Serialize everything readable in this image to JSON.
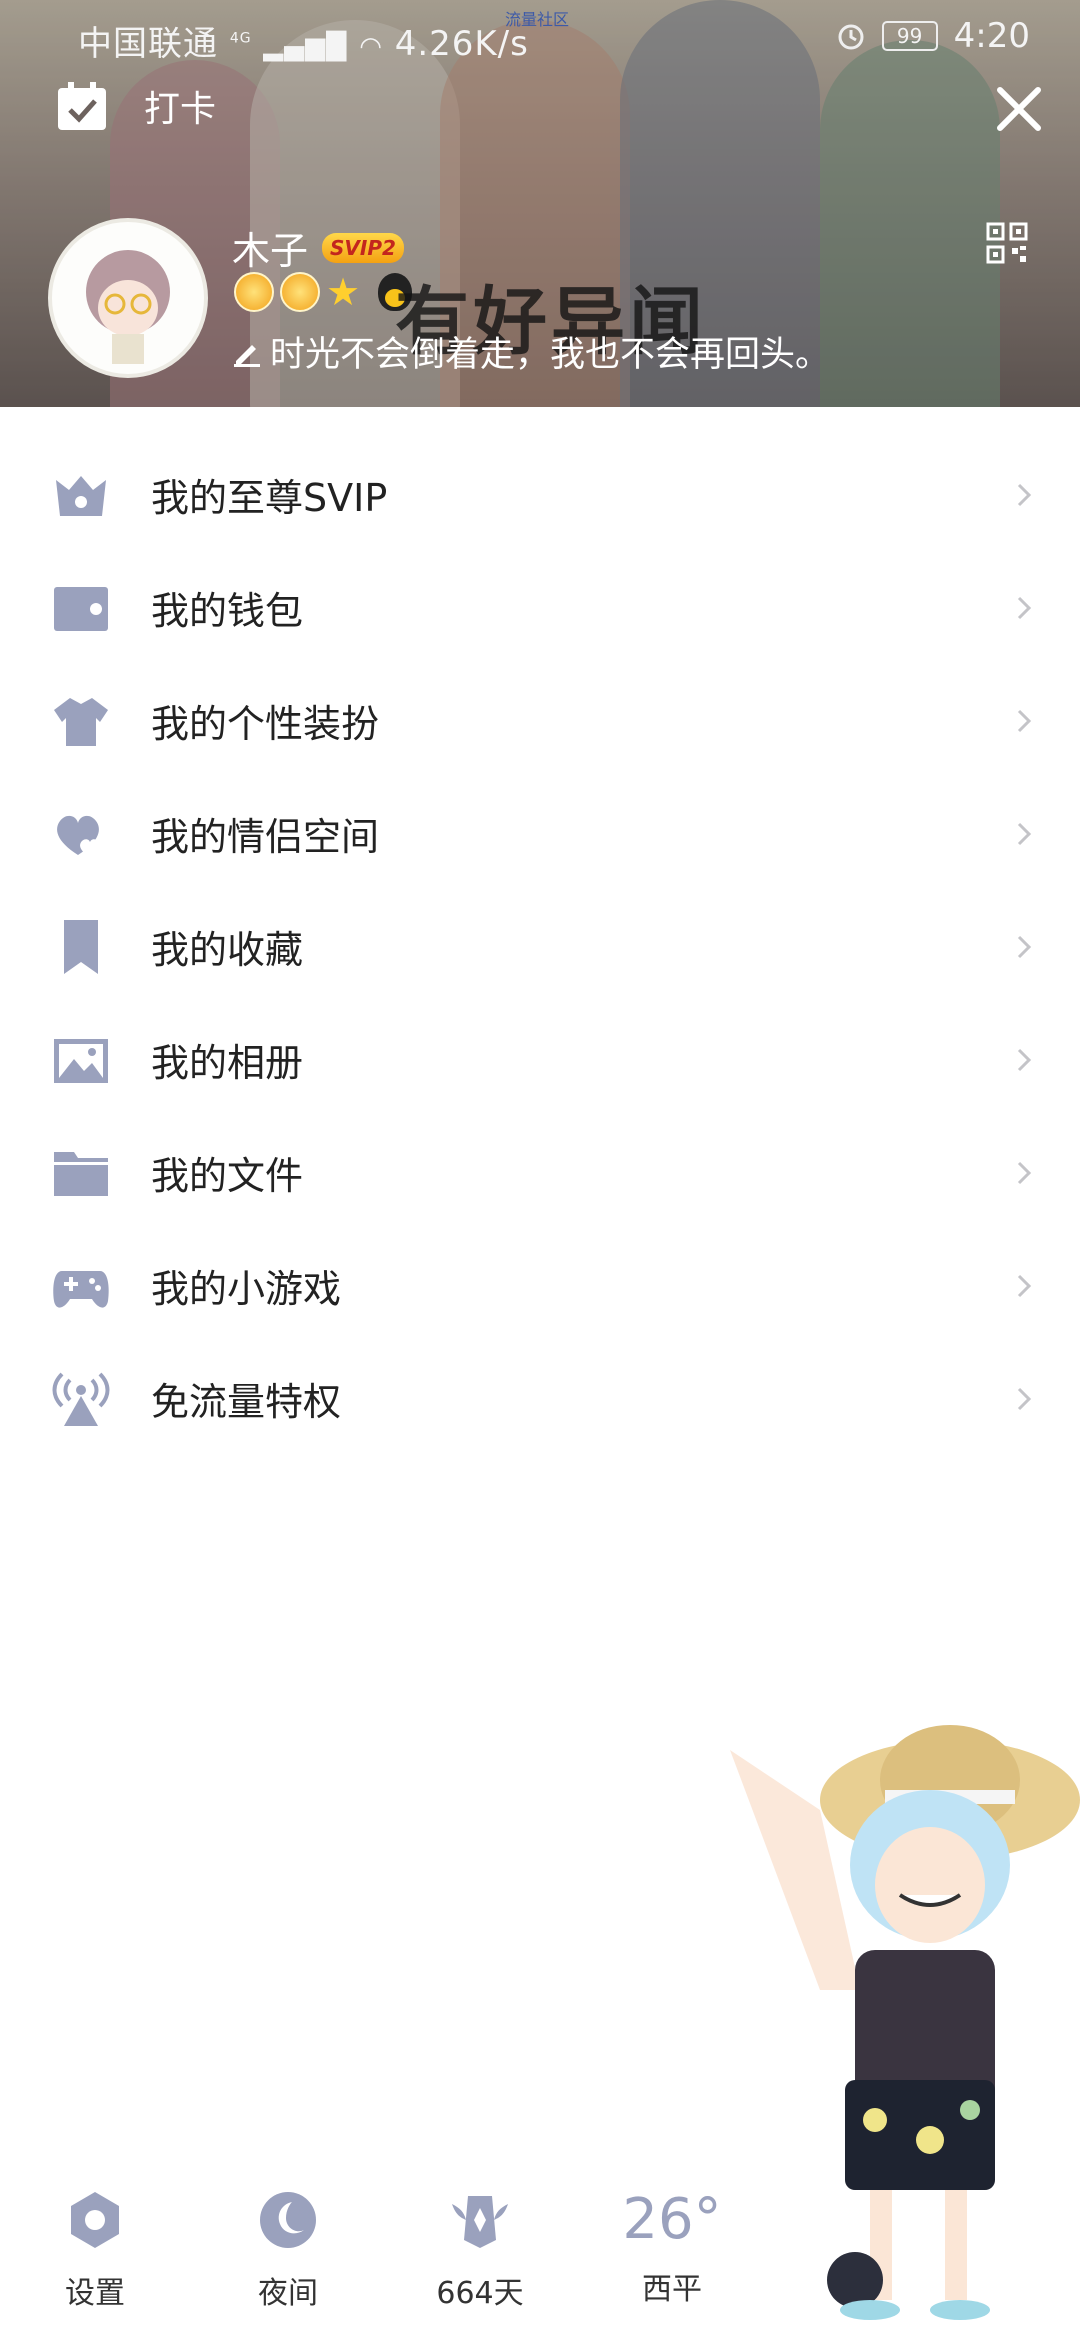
{
  "status_bar": {
    "carrier": "中国联通",
    "network": "4G",
    "speed": "4.26K/s",
    "center_text": "流量社区",
    "battery": "99",
    "time": "4:20"
  },
  "header": {
    "checkin_label": "打卡",
    "username": "木子",
    "vip_badge": "SVIP2",
    "signature": "时光不会倒着走，我也不会再回头。",
    "banner_text": "有好异闻"
  },
  "menu": {
    "items": [
      {
        "label": "我的至尊SVIP",
        "icon": "vip-crown-icon"
      },
      {
        "label": "我的钱包",
        "icon": "wallet-icon"
      },
      {
        "label": "我的个性装扮",
        "icon": "tshirt-icon"
      },
      {
        "label": "我的情侣空间",
        "icon": "hearts-icon"
      },
      {
        "label": "我的收藏",
        "icon": "bookmark-icon"
      },
      {
        "label": "我的相册",
        "icon": "image-icon"
      },
      {
        "label": "我的文件",
        "icon": "folder-icon"
      },
      {
        "label": "我的小游戏",
        "icon": "gamepad-icon"
      },
      {
        "label": "免流量特权",
        "icon": "signal-tower-icon"
      }
    ]
  },
  "bottom": {
    "settings_label": "设置",
    "night_label": "夜间",
    "days_label": "664天",
    "temperature": "26°",
    "city": "西平"
  },
  "colors": {
    "icon": "#9aa1bd",
    "text": "#222222",
    "chevron": "#c4c4c8"
  }
}
